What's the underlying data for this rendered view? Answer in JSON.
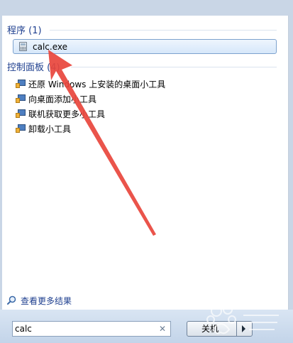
{
  "programs": {
    "heading": "程序 (1)",
    "items": [
      {
        "label": "calc.exe",
        "icon": "calculator-icon"
      }
    ]
  },
  "control_panel": {
    "heading": "控制面板 (4)",
    "items": [
      {
        "label": "还原 Windows 上安装的桌面小工具",
        "icon": "gadget-icon"
      },
      {
        "label": "向桌面添加小工具",
        "icon": "gadget-icon"
      },
      {
        "label": "联机获取更多小工具",
        "icon": "gadget-icon"
      },
      {
        "label": "卸载小工具",
        "icon": "gadget-icon"
      }
    ]
  },
  "see_more": {
    "label": "查看更多结果",
    "icon": "search-icon"
  },
  "search": {
    "value": "calc",
    "clear_icon": "close-icon"
  },
  "shutdown": {
    "label": "关机",
    "icon": "chevron-right-icon"
  },
  "colors": {
    "heading": "#1e3f8f",
    "highlight_border": "#7da2ce",
    "annotation_arrow": "#e8453c"
  }
}
